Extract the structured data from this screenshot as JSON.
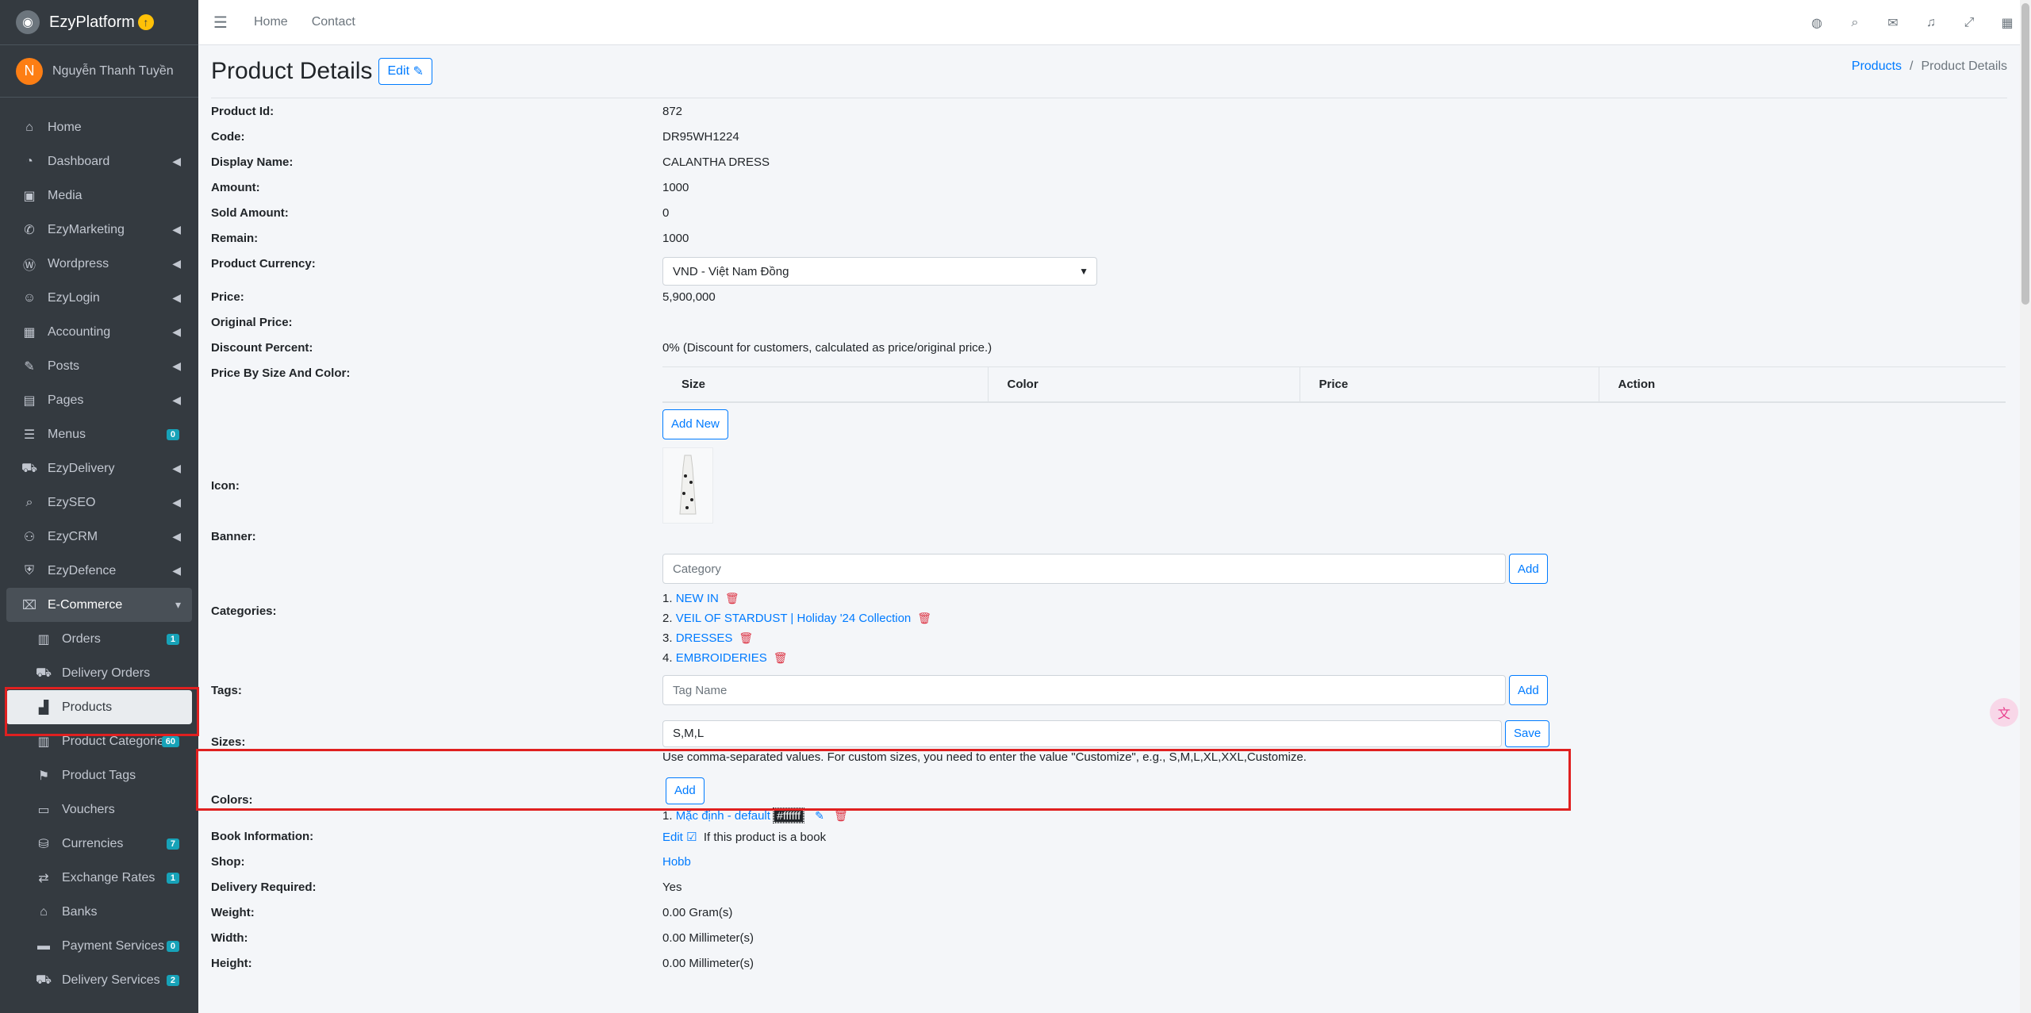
{
  "brand": {
    "name": "EzyPlatform"
  },
  "user": {
    "initial": "N",
    "name": "Nguyễn Thanh Tuyền"
  },
  "sidebar": {
    "items": [
      {
        "label": "Home",
        "icon": "home-icon",
        "chevron": false,
        "badge": ""
      },
      {
        "label": "Dashboard",
        "icon": "dashboard-icon",
        "chevron": true,
        "badge": ""
      },
      {
        "label": "Media",
        "icon": "media-icon",
        "chevron": false,
        "badge": ""
      },
      {
        "label": "EzyMarketing",
        "icon": "megaphone-icon",
        "chevron": true,
        "badge": ""
      },
      {
        "label": "Wordpress",
        "icon": "wordpress-icon",
        "chevron": true,
        "badge": ""
      },
      {
        "label": "EzyLogin",
        "icon": "user-lock-icon",
        "chevron": true,
        "badge": ""
      },
      {
        "label": "Accounting",
        "icon": "calculator-icon",
        "chevron": true,
        "badge": ""
      },
      {
        "label": "Posts",
        "icon": "posts-icon",
        "chevron": true,
        "badge": ""
      },
      {
        "label": "Pages",
        "icon": "pages-icon",
        "chevron": true,
        "badge": ""
      },
      {
        "label": "Menus",
        "icon": "menu-icon",
        "chevron": false,
        "badge": "0"
      },
      {
        "label": "EzyDelivery",
        "icon": "truck-icon",
        "chevron": true,
        "badge": ""
      },
      {
        "label": "EzySEO",
        "icon": "seo-icon",
        "chevron": true,
        "badge": ""
      },
      {
        "label": "EzyCRM",
        "icon": "crm-icon",
        "chevron": true,
        "badge": ""
      },
      {
        "label": "EzyDefence",
        "icon": "shield-icon",
        "chevron": true,
        "badge": ""
      }
    ],
    "ecommerce": {
      "label": "E-Commerce"
    },
    "sub_items": [
      {
        "label": "Orders",
        "icon": "orders-icon",
        "badge": "1"
      },
      {
        "label": "Delivery Orders",
        "icon": "delivery-orders-icon",
        "badge": ""
      },
      {
        "label": "Products",
        "icon": "products-icon",
        "badge": ""
      },
      {
        "label": "Product Categories",
        "icon": "categories-icon",
        "badge": "60"
      },
      {
        "label": "Product Tags",
        "icon": "tags-icon",
        "badge": ""
      },
      {
        "label": "Vouchers",
        "icon": "voucher-icon",
        "badge": ""
      },
      {
        "label": "Currencies",
        "icon": "currency-icon",
        "badge": "7"
      },
      {
        "label": "Exchange Rates",
        "icon": "exchange-icon",
        "badge": "1"
      },
      {
        "label": "Banks",
        "icon": "bank-icon",
        "badge": ""
      },
      {
        "label": "Payment Services",
        "icon": "payment-icon",
        "badge": "0"
      },
      {
        "label": "Delivery Services",
        "icon": "delivery-icon",
        "badge": "2"
      }
    ]
  },
  "topbar": {
    "links": [
      "Home",
      "Contact"
    ]
  },
  "page": {
    "title": "Product Details",
    "edit_label": "Edit",
    "breadcrumb": {
      "parent": "Products",
      "current": "Product Details"
    }
  },
  "fields": {
    "product_id": {
      "label": "Product Id:",
      "value": "872"
    },
    "code": {
      "label": "Code:",
      "value": "DR95WH1224"
    },
    "display_name": {
      "label": "Display Name:",
      "value": "CALANTHA DRESS"
    },
    "amount": {
      "label": "Amount:",
      "value": "1000"
    },
    "sold_amount": {
      "label": "Sold Amount:",
      "value": "0"
    },
    "remain": {
      "label": "Remain:",
      "value": "1000"
    },
    "currency": {
      "label": "Product Currency:",
      "value": "VND - Việt Nam Đồng"
    },
    "price": {
      "label": "Price:",
      "value": "5,900,000"
    },
    "original_price": {
      "label": "Original Price:",
      "value": ""
    },
    "discount": {
      "label": "Discount Percent:",
      "value": "0% (Discount for customers, calculated as price/original price.)"
    },
    "price_by_size": {
      "label": "Price By Size And Color:",
      "columns": [
        "Size",
        "Color",
        "Price",
        "Action"
      ],
      "add_label": "Add New"
    },
    "icon": {
      "label": "Icon:"
    },
    "banner": {
      "label": "Banner:"
    },
    "categories": {
      "label": "Categories:",
      "placeholder": "Category",
      "add_label": "Add",
      "items": [
        {
          "num": "1.",
          "name": "NEW IN"
        },
        {
          "num": "2.",
          "name": "VEIL OF STARDUST | Holiday '24 Collection"
        },
        {
          "num": "3.",
          "name": "DRESSES"
        },
        {
          "num": "4.",
          "name": "EMBROIDERIES"
        }
      ]
    },
    "tags": {
      "label": "Tags:",
      "placeholder": "Tag Name",
      "add_label": "Add"
    },
    "sizes": {
      "label": "Sizes:",
      "value": "S,M,L",
      "save_label": "Save",
      "hint": "Use comma-separated values. For custom sizes, you need to enter the value \"Customize\", e.g., S,M,L,XL,XXL,Customize."
    },
    "colors": {
      "label": "Colors:",
      "add_label": "Add",
      "item_num": "1.",
      "item_name": "Mặc định - default",
      "item_hex": "#ffffff"
    },
    "book": {
      "label": "Book Information:",
      "edit_label": "Edit",
      "hint": "If this product is a book"
    },
    "shop": {
      "label": "Shop:",
      "value": "Hobb"
    },
    "delivery": {
      "label": "Delivery Required:",
      "value": "Yes"
    },
    "weight": {
      "label": "Weight:",
      "value": "0.00 Gram(s)"
    },
    "width": {
      "label": "Width:",
      "value": "0.00 Millimeter(s)"
    },
    "height": {
      "label": "Height:",
      "value": "0.00 Millimeter(s)"
    }
  },
  "colors": {
    "primary": "#007bff",
    "danger": "#dc3545",
    "sidebar_bg": "#343a40",
    "highlight": "#e02020"
  }
}
